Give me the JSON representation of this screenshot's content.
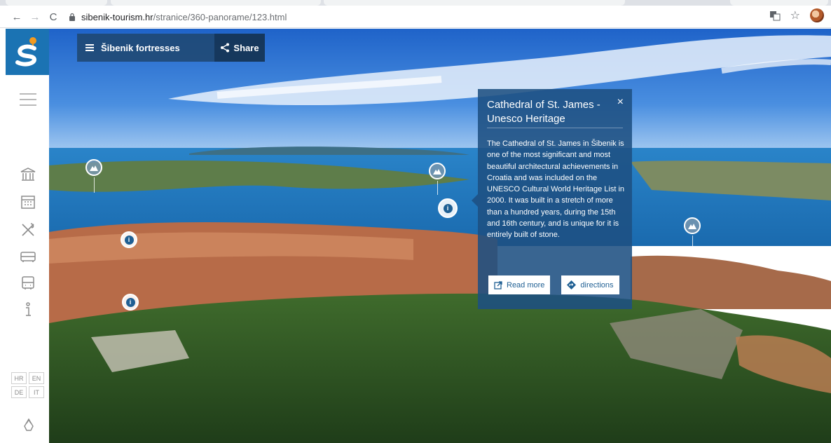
{
  "browser": {
    "url_host": "sibenik-tourism.hr",
    "url_path": "/stranice/360-panorame/123.html"
  },
  "panorama": {
    "menu_label": "Šibenik fortresses",
    "share_label": "Share"
  },
  "sidebar": {
    "icons": [
      "museum-icon",
      "calendar-icon",
      "restaurant-icon",
      "car-icon",
      "bus-icon",
      "info-icon"
    ],
    "languages": [
      "HR",
      "EN",
      "DE",
      "IT"
    ]
  },
  "infobox": {
    "title": "Cathedral of St. James - Unesco Heritage",
    "close": "×",
    "body": "The Cathedral of St. James in Šibenik is one of the most significant and most beautiful architectural achievements in Croatia and was included on the UNESCO Cultural World Heritage List in 2000. It was built in a stretch of more than a hundred years, during the 15th and 16th century, and is unique for it is entirely built of stone.",
    "read_more": "Read more",
    "directions": "directions"
  },
  "colors": {
    "brand": "#1b73b3",
    "infobox": "#1e5082"
  }
}
